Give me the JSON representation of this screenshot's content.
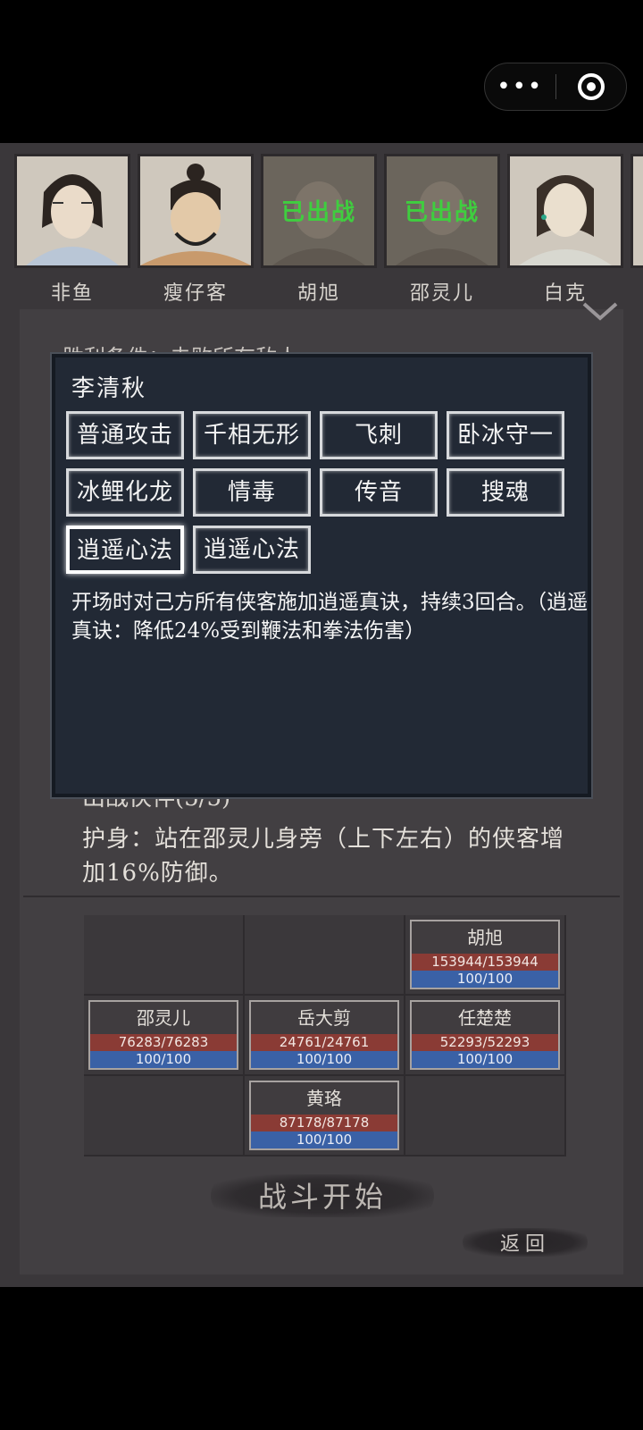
{
  "capsule": {
    "more_icon": "more-dots-icon",
    "close_icon": "target-circle-icon"
  },
  "heroes": [
    {
      "name": "非鱼",
      "deployed": ""
    },
    {
      "name": "瘦仔客",
      "deployed": ""
    },
    {
      "name": "胡旭",
      "deployed": "已出战"
    },
    {
      "name": "邵灵儿",
      "deployed": "已出战"
    },
    {
      "name": "白克",
      "deployed": ""
    }
  ],
  "victory_text": "胜利条件：击败所有敌人",
  "partners_label": "出战伙伴(5/5)",
  "buff_text": "护身：站在邵灵儿身旁（上下左右）的侠客增加16%防御。",
  "formation": [
    {
      "name": "胡旭",
      "hp": "153944/153944",
      "mp": "100/100"
    },
    {
      "name": "邵灵儿",
      "hp": "76283/76283",
      "mp": "100/100"
    },
    {
      "name": "岳大剪",
      "hp": "24761/24761",
      "mp": "100/100"
    },
    {
      "name": "任楚楚",
      "hp": "52293/52293",
      "mp": "100/100"
    },
    {
      "name": "黄珞",
      "hp": "87178/87178",
      "mp": "100/100"
    }
  ],
  "buttons": {
    "start": "战斗开始",
    "back": "返回"
  },
  "dialog": {
    "title": "李清秋",
    "skills": [
      "普通攻击",
      "千相无形",
      "飞刺",
      "卧冰守一",
      "冰鲤化龙",
      "情毒",
      "传音",
      "搜魂",
      "逍遥心法",
      "逍遥心法"
    ],
    "selected_index": 8,
    "description": "开场时对己方所有侠客施加逍遥真诀，持续3回合。（逍遥真诀：降低24%受到鞭法和拳法伤害）"
  }
}
